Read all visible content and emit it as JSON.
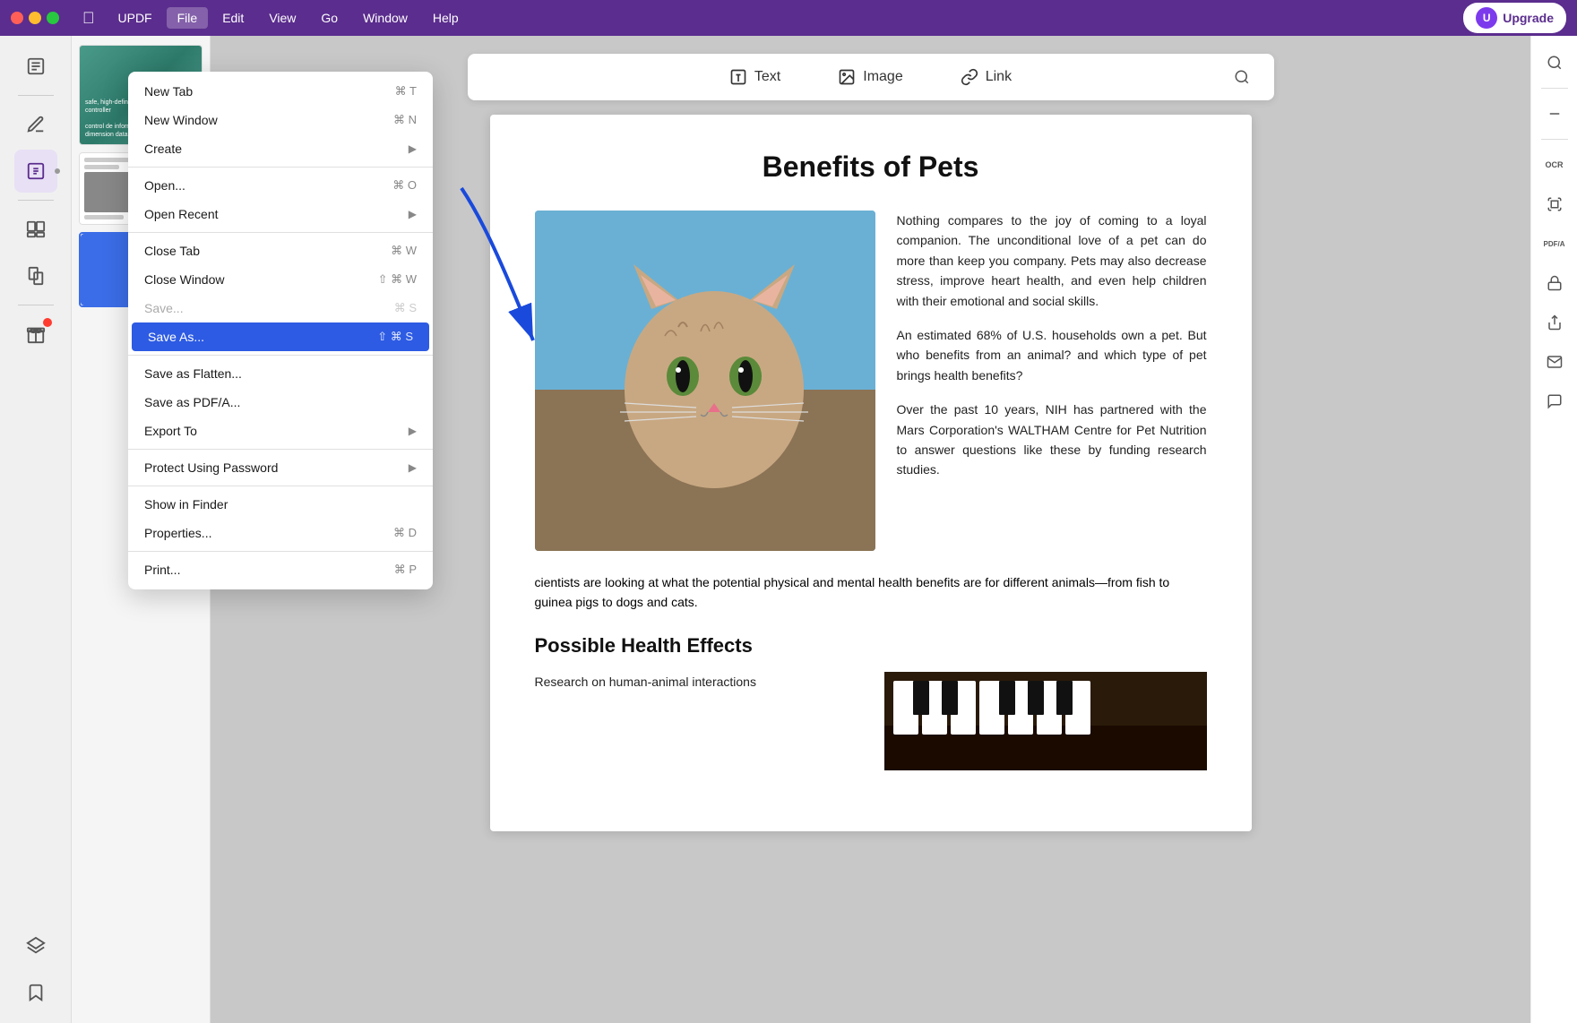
{
  "menubar": {
    "apple_icon": "⌘",
    "app_name": "UPDF",
    "items": [
      "File",
      "Edit",
      "View",
      "Go",
      "Window",
      "Help"
    ],
    "active_item": "File",
    "upgrade_label": "Upgrade",
    "upgrade_avatar": "U"
  },
  "dropdown": {
    "items": [
      {
        "label": "New Tab",
        "shortcut": "⌘ T",
        "has_arrow": false,
        "disabled": false
      },
      {
        "label": "New Window",
        "shortcut": "⌘ N",
        "has_arrow": false,
        "disabled": false
      },
      {
        "label": "Create",
        "shortcut": "",
        "has_arrow": true,
        "disabled": false
      },
      {
        "divider": true
      },
      {
        "label": "Open...",
        "shortcut": "⌘ O",
        "has_arrow": false,
        "disabled": false
      },
      {
        "label": "Open Recent",
        "shortcut": "",
        "has_arrow": true,
        "disabled": false
      },
      {
        "divider": true
      },
      {
        "label": "Close Tab",
        "shortcut": "⌘ W",
        "has_arrow": false,
        "disabled": false
      },
      {
        "label": "Close Window",
        "shortcut": "⇧ ⌘ W",
        "has_arrow": false,
        "disabled": false
      },
      {
        "label": "Save...",
        "shortcut": "⌘ S",
        "has_arrow": false,
        "disabled": true
      },
      {
        "label": "Save As...",
        "shortcut": "⇧ ⌘ S",
        "has_arrow": false,
        "disabled": false,
        "highlighted": true
      },
      {
        "divider": true
      },
      {
        "label": "Save as Flatten...",
        "shortcut": "",
        "has_arrow": false,
        "disabled": false
      },
      {
        "label": "Save as PDF/A...",
        "shortcut": "",
        "has_arrow": false,
        "disabled": false
      },
      {
        "label": "Export To",
        "shortcut": "",
        "has_arrow": true,
        "disabled": false
      },
      {
        "divider": true
      },
      {
        "label": "Protect Using Password",
        "shortcut": "",
        "has_arrow": true,
        "disabled": false
      },
      {
        "divider": true
      },
      {
        "label": "Show in Finder",
        "shortcut": "",
        "has_arrow": false,
        "disabled": false
      },
      {
        "label": "Properties...",
        "shortcut": "⌘ D",
        "has_arrow": false,
        "disabled": false
      },
      {
        "divider": true
      },
      {
        "label": "Print...",
        "shortcut": "⌘ P",
        "has_arrow": false,
        "disabled": false
      }
    ]
  },
  "toolbar": {
    "text_label": "Text",
    "image_label": "Image",
    "link_label": "Link"
  },
  "pdf": {
    "title": "Benefits of Pets",
    "paragraph1": "Nothing compares to the joy of coming to a loyal companion. The unconditional love of a pet can do more than keep you company. Pets may also decrease stress, improve heart health,  and even help children  with  their emotional and social skills.",
    "paragraph2": "An estimated 68% of U.S. households own a pet. But who benefits from an animal? and which type of pet brings health benefits?",
    "paragraph3": "Over the past 10 years, NIH has partnered with the Mars Corporation's WALTHAM Centre for Pet Nutrition to answer  questions  like these by funding research studies.",
    "paragraph_bottom": "cientists are looking at what the potential physical and mental health benefits are for different animals—from fish to guinea pigs to dogs and cats.",
    "section2_title": "Possible Health Effects",
    "section2_text": "Research on human-animal interactions"
  }
}
